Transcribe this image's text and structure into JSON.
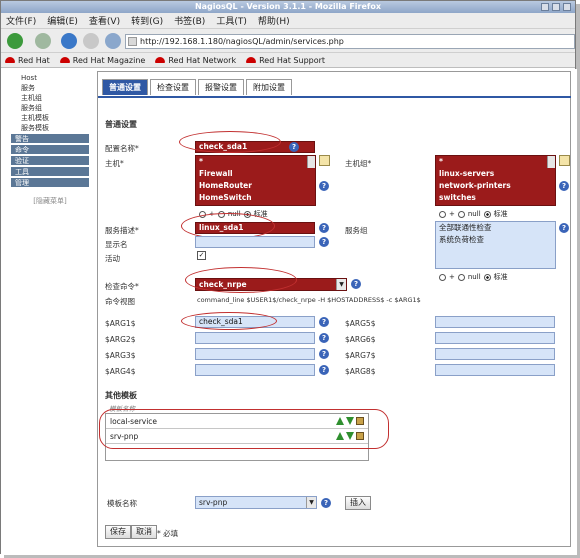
{
  "window": {
    "title": "NagiosQL - Version 3.1.1 - Mozilla Firefox"
  },
  "menu": [
    "文件(F)",
    "编辑(E)",
    "查看(V)",
    "转到(G)",
    "书签(B)",
    "工具(T)",
    "帮助(H)"
  ],
  "toolbar": {
    "url": "http://192.168.1.180/nagiosQL/admin/services.php"
  },
  "bookmarks": [
    "Red Hat",
    "Red Hat Magazine",
    "Red Hat Network",
    "Red Hat Support"
  ],
  "sidebar": {
    "top_items": [
      "Host",
      "服务",
      "主机组",
      "服务组",
      "主机模板",
      "服务模板"
    ],
    "sections": [
      "警告",
      "命令",
      "验证",
      "工具",
      "管理"
    ],
    "collapse": "[隐藏菜单]"
  },
  "tabs": [
    "普通设置",
    "检查设置",
    "报警设置",
    "附加设置"
  ],
  "form": {
    "section_title": "普通设置",
    "config_name_label": "配置名称*",
    "config_name_value": "check_sda1",
    "host_label": "主机*",
    "host_options": [
      "*",
      "Firewall",
      "HomeRouter",
      "HomeSwitch"
    ],
    "hostgroup_label": "主机组*",
    "hostgroup_options": [
      "*",
      "linux-servers",
      "network-printers",
      "switches"
    ],
    "radio_plus": "+",
    "radio_null": "null",
    "radio_std": "标准",
    "service_desc_label": "服务描述*",
    "service_desc_value": "linux_sda1",
    "display_name_label": "显示名",
    "servicegroup_label": "服务组",
    "servicegroup_options": [
      "全部联通性检查",
      "系统负荷检查"
    ],
    "active_label": "活动",
    "check_cmd_label": "检查命令*",
    "check_cmd_value": "check_nrpe",
    "cmd_view_label": "命令视图",
    "cmd_view_value": "command_line $USER1$/check_nrpe -H $HOSTADDRESS$ -c $ARG1$",
    "args_left": [
      "$ARG1$",
      "$ARG2$",
      "$ARG3$",
      "$ARG4$"
    ],
    "arg1_value": "check_sda1",
    "args_right": [
      "$ARG5$",
      "$ARG6$",
      "$ARG7$",
      "$ARG8$"
    ],
    "template_section": "其他模板",
    "template_col": "模板名称",
    "templates": [
      "local-service",
      "srv-pnp"
    ],
    "template_name_label": "模板名称",
    "template_select": "srv-pnp",
    "insert_button": "插入",
    "save_button": "保存",
    "cancel_button": "取消",
    "required_note": "* 必填"
  }
}
